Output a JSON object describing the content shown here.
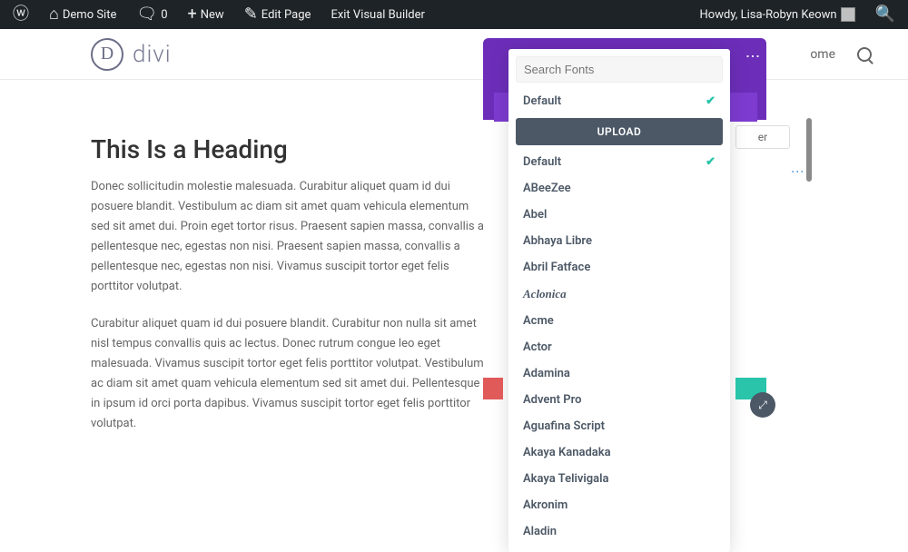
{
  "wpbar": {
    "site_name": "Demo Site",
    "comments": "0",
    "new": "New",
    "edit_page": "Edit Page",
    "exit_builder": "Exit Visual Builder",
    "howdy": "Howdy, Lisa-Robyn Keown"
  },
  "header": {
    "logo_letter": "D",
    "logo_text": "divi",
    "nav_home": "ome"
  },
  "content": {
    "heading": "This Is a Heading",
    "p1": "Donec sollicitudin molestie malesuada. Curabitur aliquet quam id dui posuere blandit. Vestibulum ac diam sit amet quam vehicula elementum sed sit amet dui. Proin eget tortor risus. Praesent sapien massa, convallis a pellentesque nec, egestas non nisi. Praesent sapien massa, convallis a pellentesque nec, egestas non nisi. Vivamus suscipit tortor eget felis porttitor volutpat.",
    "p2": "Curabitur aliquet quam id dui posuere blandit. Curabitur non nulla sit amet nisl tempus convallis quis ac lectus. Donec rutrum congue leo eget malesuada. Vivamus suscipit tortor eget felis porttitor volutpat. Vestibulum ac diam sit amet quam vehicula elementum sed sit amet dui. Pellentesque in ipsum id orci porta dapibus. Vivamus suscipit tortor eget felis porttitor volutpat."
  },
  "font_panel": {
    "search_placeholder": "Search Fonts",
    "upload": "UPLOAD",
    "default": "Default",
    "fonts": {
      "0": "ABeeZee",
      "1": "Abel",
      "2": "Abhaya Libre",
      "3": "Abril Fatface",
      "4": "Aclonica",
      "5": "Acme",
      "6": "Actor",
      "7": "Adamina",
      "8": "Advent Pro",
      "9": "Aguafina Script",
      "10": "Akaya Kanadaka",
      "11": "Akaya Telivigala",
      "12": "Akronim",
      "13": "Aladin"
    }
  },
  "right_ctrl": {
    "box_label": "er"
  }
}
